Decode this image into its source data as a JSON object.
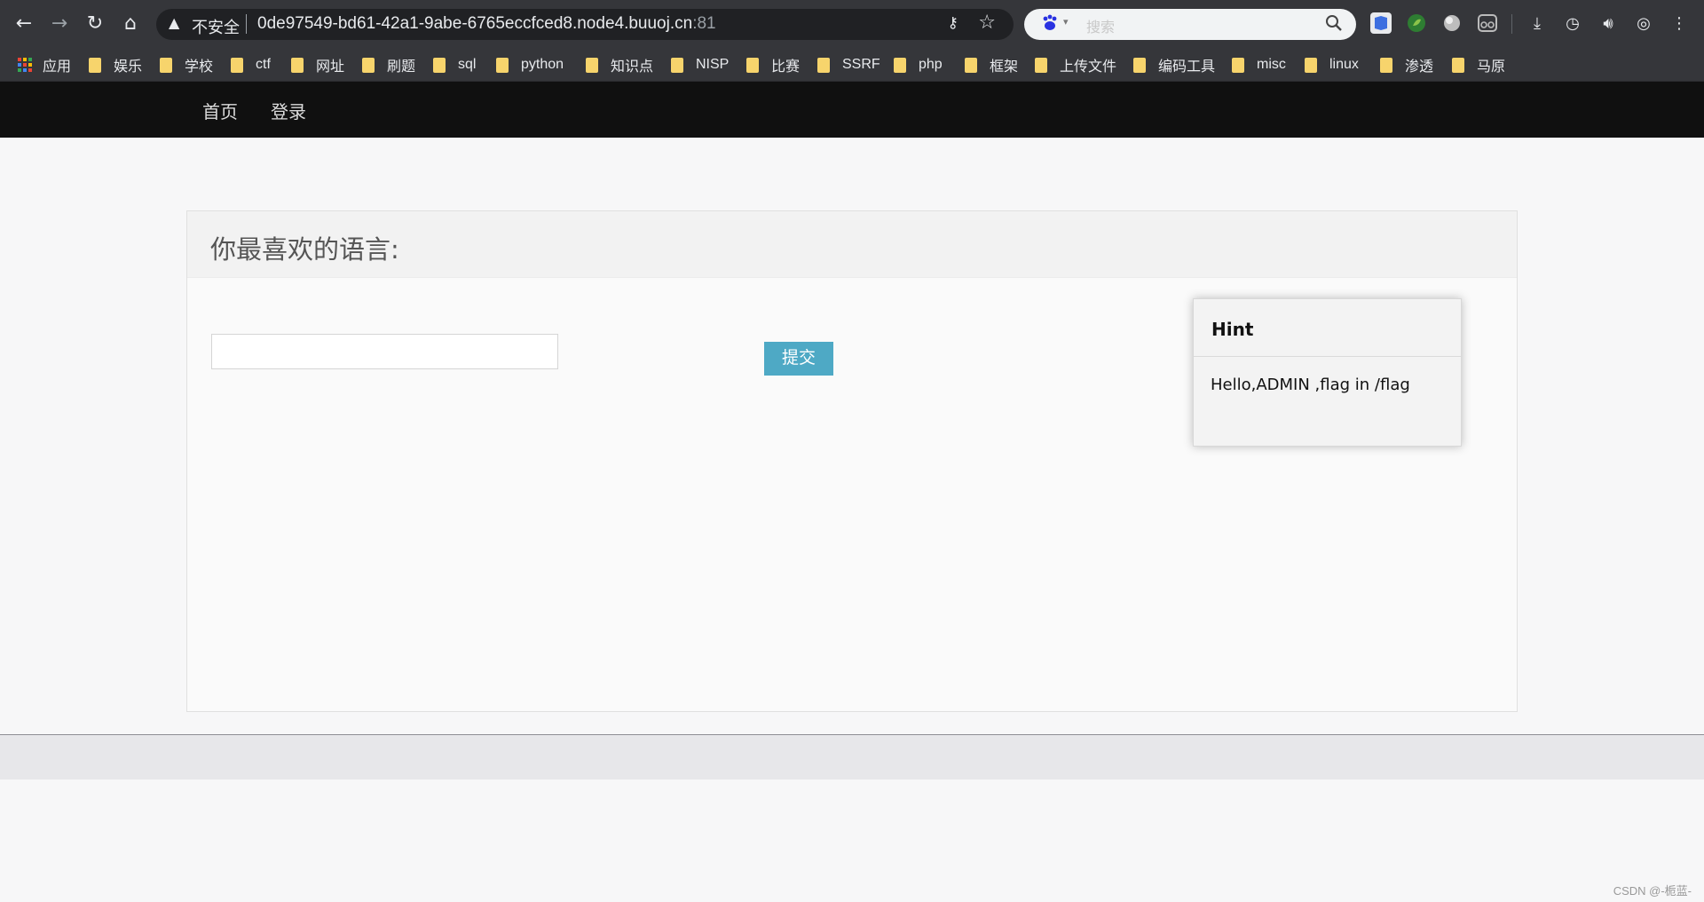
{
  "browser": {
    "security_label": "不安全",
    "url_host": "0de97549-bd61-42a1-9abe-6765eccfced8.node4.buuoj.cn",
    "url_port": ":81",
    "search_placeholder": "搜索"
  },
  "bookmarks": [
    {
      "label": "应用",
      "icon": "apps-grid-icon"
    },
    {
      "label": "娱乐",
      "icon": "folder-icon"
    },
    {
      "label": "学校",
      "icon": "folder-icon"
    },
    {
      "label": "ctf",
      "icon": "folder-icon"
    },
    {
      "label": "网址",
      "icon": "folder-icon"
    },
    {
      "label": "刷题",
      "icon": "folder-icon"
    },
    {
      "label": "sql",
      "icon": "folder-icon"
    },
    {
      "label": "python",
      "icon": "folder-icon"
    },
    {
      "label": "知识点",
      "icon": "folder-icon"
    },
    {
      "label": "NISP",
      "icon": "folder-icon"
    },
    {
      "label": "比赛",
      "icon": "folder-icon"
    },
    {
      "label": "SSRF",
      "icon": "folder-icon"
    },
    {
      "label": "php",
      "icon": "folder-icon"
    },
    {
      "label": "框架",
      "icon": "folder-icon"
    },
    {
      "label": "上传文件",
      "icon": "folder-icon"
    },
    {
      "label": "编码工具",
      "icon": "folder-icon"
    },
    {
      "label": "misc",
      "icon": "folder-icon"
    },
    {
      "label": "linux",
      "icon": "folder-icon"
    },
    {
      "label": "渗透",
      "icon": "folder-icon"
    },
    {
      "label": "马原",
      "icon": "folder-icon"
    }
  ],
  "site_nav": {
    "home": "首页",
    "login": "登录"
  },
  "panel": {
    "title": "你最喜欢的语言:",
    "input_value": "",
    "submit_label": "提交"
  },
  "hint": {
    "title": "Hint",
    "body": "Hello,ADMIN ,flag in /flag"
  },
  "watermark": "CSDN @-栀蓝-",
  "colors": {
    "chrome_bg": "#35363a",
    "nav_bg": "#101010",
    "submit_bg": "#4ea9c5",
    "folder": "#f7d46c"
  }
}
